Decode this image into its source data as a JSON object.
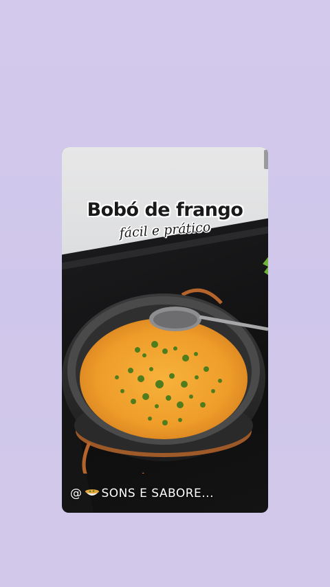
{
  "post": {
    "title": "Bobó de frango",
    "subtitle": "fácil e prático",
    "watermark_at": "@",
    "watermark_text": "SONS E SABORE..."
  },
  "colors": {
    "background": "#d3c9ec",
    "title_text": "#1a1a1a",
    "title_outline": "#ffffff",
    "stew": "#f2a631",
    "herbs": "#4f7d1e",
    "pot": "#2a2a2b",
    "copper": "#b5652c"
  },
  "icons": {
    "bowl": "bowl-icon"
  }
}
